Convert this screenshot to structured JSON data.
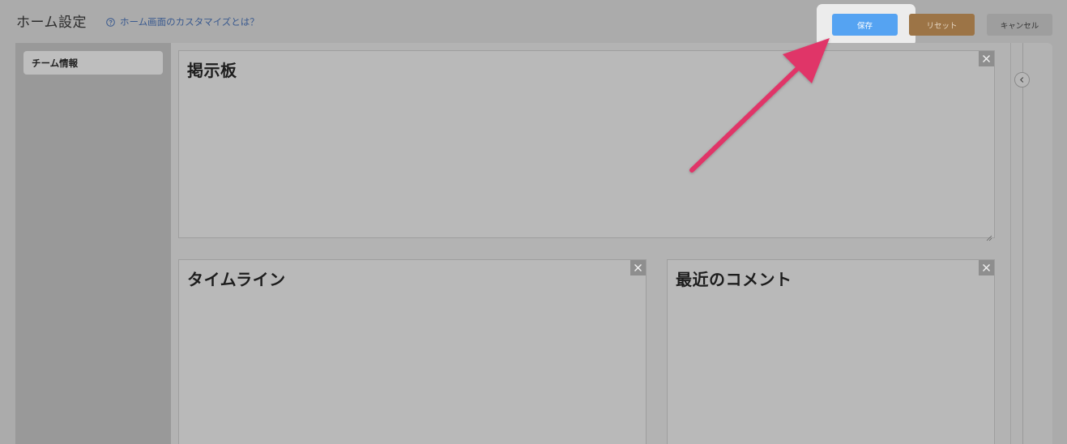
{
  "header": {
    "title": "ホーム設定",
    "help_link": "ホーム画面のカスタマイズとは？",
    "help_icon": "question-circle-icon"
  },
  "toolbar": {
    "save_label": "保存",
    "reset_label": "リセット",
    "cancel_label": "キャンセル"
  },
  "sidebar": {
    "items": [
      {
        "label": "チーム情報"
      }
    ]
  },
  "widgets": {
    "board": {
      "title": "掲示板"
    },
    "timeline": {
      "title": "タイムライン"
    },
    "recent_comments": {
      "title": "最近のコメント"
    }
  },
  "colors": {
    "save": "#55a3f2",
    "reset": "#9c7446",
    "cancel": "#9e9e9e",
    "annotation_arrow": "#e03568"
  },
  "icons": {
    "close": "close-icon",
    "collapse": "chevron-left-icon",
    "resize": "resize-grip-icon"
  }
}
